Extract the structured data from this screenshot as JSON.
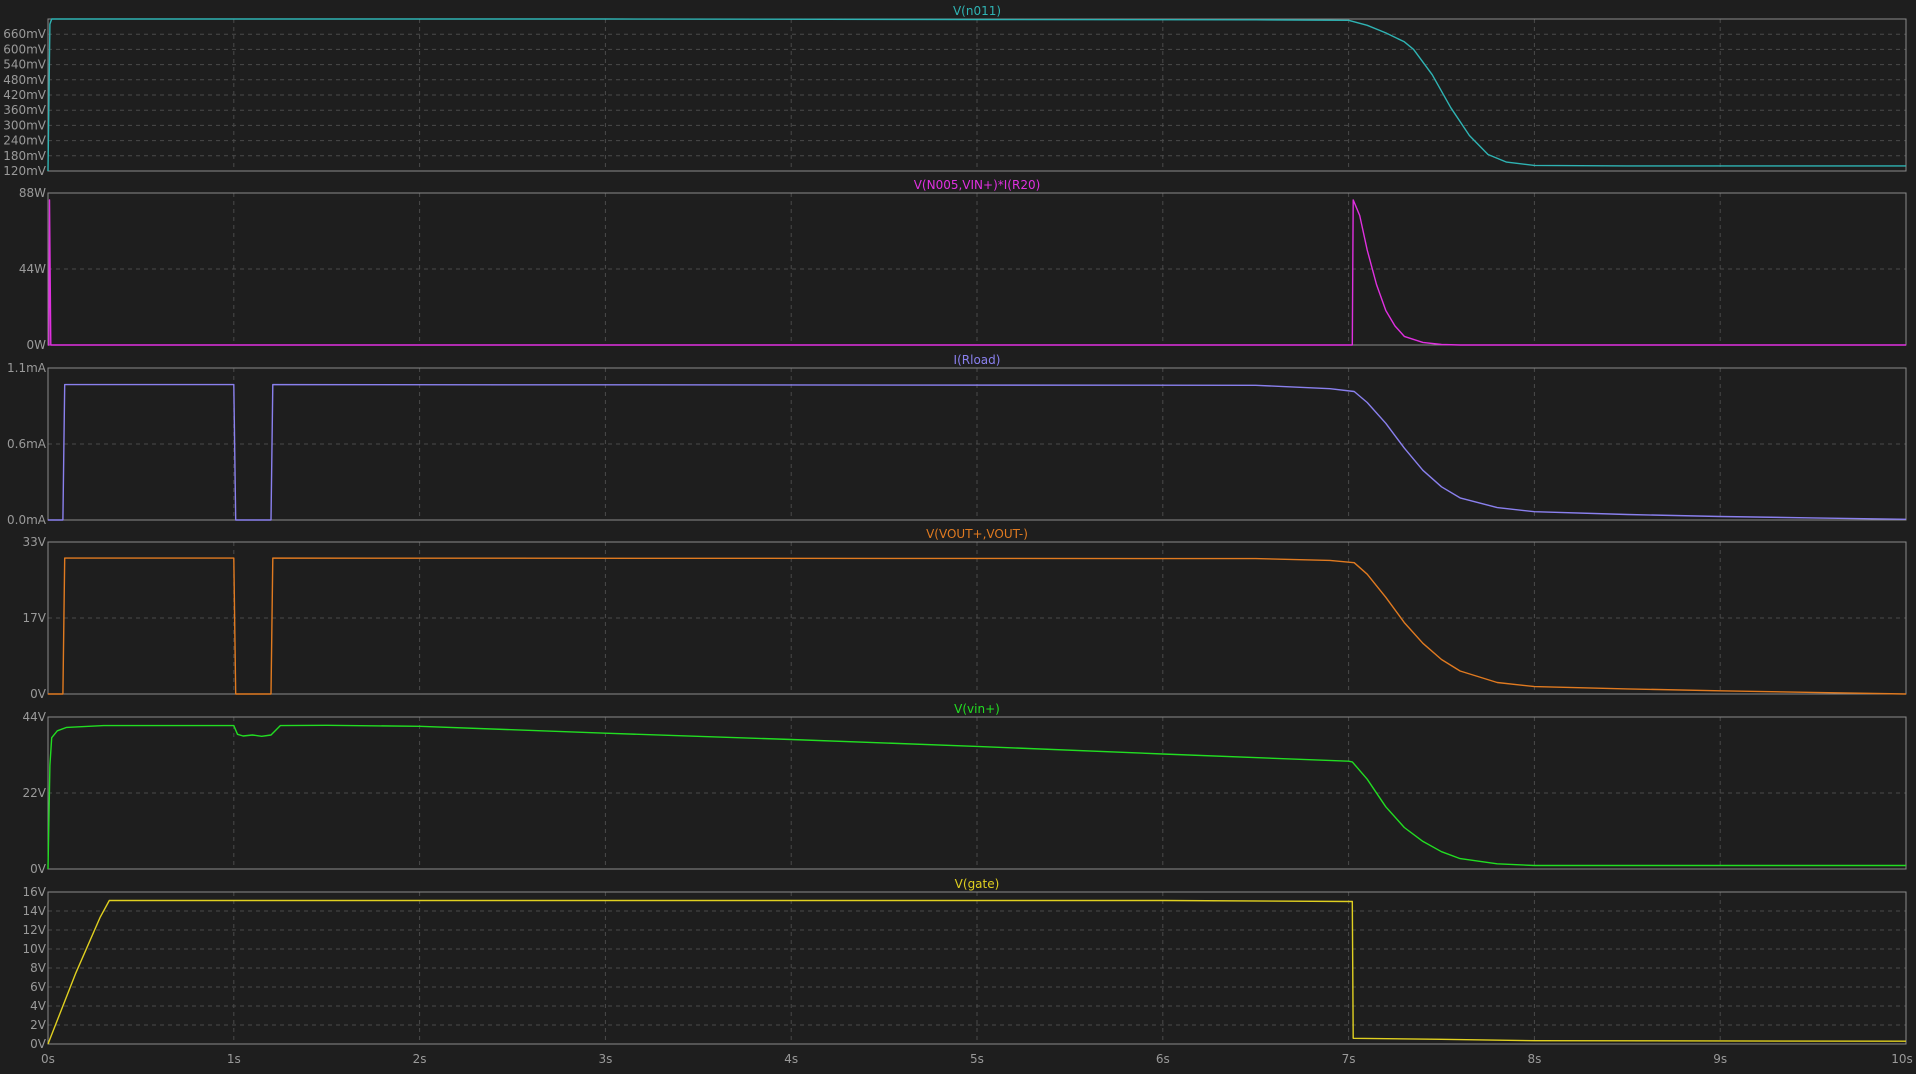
{
  "chart_data": {
    "type": "line",
    "x_ticks": [
      "0s",
      "1s",
      "2s",
      "3s",
      "4s",
      "5s",
      "6s",
      "7s",
      "8s",
      "9s",
      "10s"
    ],
    "xlim": [
      0,
      10
    ],
    "grid": true,
    "panes": [
      {
        "id": "n011",
        "title": "V(n011)",
        "color": "#2fb3b3",
        "ylim": [
          0.12,
          0.72
        ],
        "y_ticks": [
          "120mV",
          "180mV",
          "240mV",
          "300mV",
          "360mV",
          "420mV",
          "480mV",
          "540mV",
          "600mV",
          "660mV"
        ],
        "y_tick_values": [
          0.12,
          0.18,
          0.24,
          0.3,
          0.36,
          0.42,
          0.48,
          0.54,
          0.6,
          0.66
        ],
        "points": [
          [
            0,
            0.12
          ],
          [
            0.01,
            0.7
          ],
          [
            0.02,
            0.72
          ],
          [
            1.0,
            0.72
          ],
          [
            1.3,
            0.72
          ],
          [
            2.0,
            0.72
          ],
          [
            3.0,
            0.72
          ],
          [
            5.0,
            0.718
          ],
          [
            6.5,
            0.717
          ],
          [
            7.0,
            0.715
          ],
          [
            7.1,
            0.695
          ],
          [
            7.2,
            0.665
          ],
          [
            7.3,
            0.63
          ],
          [
            7.35,
            0.6
          ],
          [
            7.45,
            0.5
          ],
          [
            7.55,
            0.37
          ],
          [
            7.65,
            0.26
          ],
          [
            7.75,
            0.185
          ],
          [
            7.85,
            0.155
          ],
          [
            8.0,
            0.142
          ],
          [
            8.5,
            0.14
          ],
          [
            9.0,
            0.14
          ],
          [
            10.0,
            0.14
          ]
        ]
      },
      {
        "id": "r20",
        "title": "V(N005,VIN+)*I(R20)",
        "color": "#e030e0",
        "ylim": [
          0,
          88
        ],
        "y_ticks": [
          "0W",
          "44W",
          "88W"
        ],
        "y_tick_values": [
          0,
          44,
          88
        ],
        "points": [
          [
            0,
            0
          ],
          [
            0.005,
            0
          ],
          [
            0.008,
            84
          ],
          [
            0.015,
            0
          ],
          [
            7.02,
            0
          ],
          [
            7.025,
            84
          ],
          [
            7.06,
            75
          ],
          [
            7.1,
            55
          ],
          [
            7.15,
            35
          ],
          [
            7.2,
            20
          ],
          [
            7.25,
            11
          ],
          [
            7.3,
            5
          ],
          [
            7.4,
            1.5
          ],
          [
            7.5,
            0.3
          ],
          [
            7.6,
            0
          ],
          [
            10,
            0
          ]
        ]
      },
      {
        "id": "rload",
        "title": "I(Rload)",
        "color": "#8a80ee",
        "ylim": [
          0,
          1.1
        ],
        "y_ticks": [
          "0.0mA",
          "0.6mA",
          "1.1mA"
        ],
        "y_tick_values": [
          0,
          0.55,
          1.1
        ],
        "points": [
          [
            0,
            0
          ],
          [
            0.08,
            0
          ],
          [
            0.09,
            0.98
          ],
          [
            1.0,
            0.98
          ],
          [
            1.01,
            0
          ],
          [
            1.2,
            0
          ],
          [
            1.21,
            0.98
          ],
          [
            6.5,
            0.975
          ],
          [
            6.9,
            0.95
          ],
          [
            7.03,
            0.93
          ],
          [
            7.1,
            0.85
          ],
          [
            7.2,
            0.7
          ],
          [
            7.3,
            0.52
          ],
          [
            7.4,
            0.36
          ],
          [
            7.5,
            0.24
          ],
          [
            7.6,
            0.16
          ],
          [
            7.8,
            0.09
          ],
          [
            8.0,
            0.06
          ],
          [
            8.5,
            0.04
          ],
          [
            9.0,
            0.025
          ],
          [
            9.5,
            0.015
          ],
          [
            10.0,
            0.005
          ]
        ]
      },
      {
        "id": "vout",
        "title": "V(VOUT+,VOUT-)",
        "color": "#e07a20",
        "ylim": [
          0,
          33
        ],
        "y_ticks": [
          "0V",
          "17V",
          "33V"
        ],
        "y_tick_values": [
          0,
          16.5,
          33
        ],
        "points": [
          [
            0,
            0
          ],
          [
            0.08,
            0
          ],
          [
            0.09,
            29.5
          ],
          [
            1.0,
            29.5
          ],
          [
            1.01,
            0
          ],
          [
            1.2,
            0
          ],
          [
            1.21,
            29.5
          ],
          [
            6.5,
            29.4
          ],
          [
            6.9,
            29
          ],
          [
            7.03,
            28.5
          ],
          [
            7.1,
            26
          ],
          [
            7.2,
            21
          ],
          [
            7.3,
            15.5
          ],
          [
            7.4,
            11
          ],
          [
            7.5,
            7.5
          ],
          [
            7.6,
            5
          ],
          [
            7.8,
            2.5
          ],
          [
            8.0,
            1.6
          ],
          [
            8.5,
            1.1
          ],
          [
            9.0,
            0.7
          ],
          [
            9.5,
            0.35
          ],
          [
            10.0,
            0
          ]
        ]
      },
      {
        "id": "vin",
        "title": "V(vin+)",
        "color": "#22dd22",
        "ylim": [
          0,
          44
        ],
        "y_ticks": [
          "0V",
          "22V",
          "44V"
        ],
        "y_tick_values": [
          0,
          22,
          44
        ],
        "points": [
          [
            0,
            0
          ],
          [
            0.01,
            30
          ],
          [
            0.02,
            38
          ],
          [
            0.05,
            40
          ],
          [
            0.1,
            41
          ],
          [
            0.3,
            41.5
          ],
          [
            1.0,
            41.5
          ],
          [
            1.02,
            39
          ],
          [
            1.05,
            38.5
          ],
          [
            1.1,
            38.8
          ],
          [
            1.15,
            38.4
          ],
          [
            1.2,
            38.8
          ],
          [
            1.25,
            41.5
          ],
          [
            1.5,
            41.6
          ],
          [
            2.0,
            41.3
          ],
          [
            3.0,
            39.3
          ],
          [
            4.0,
            37.5
          ],
          [
            5.0,
            35.5
          ],
          [
            6.0,
            33.3
          ],
          [
            7.0,
            31.2
          ],
          [
            7.02,
            31
          ],
          [
            7.1,
            26
          ],
          [
            7.2,
            18
          ],
          [
            7.3,
            12
          ],
          [
            7.4,
            8
          ],
          [
            7.5,
            5
          ],
          [
            7.6,
            3
          ],
          [
            7.8,
            1.5
          ],
          [
            8.0,
            1.0
          ],
          [
            9.0,
            1.0
          ],
          [
            10.0,
            1.0
          ]
        ]
      },
      {
        "id": "gate",
        "title": "V(gate)",
        "color": "#e0d020",
        "ylim": [
          0,
          16
        ],
        "y_ticks": [
          "0V",
          "2V",
          "4V",
          "6V",
          "8V",
          "10V",
          "12V",
          "14V",
          "16V"
        ],
        "y_tick_values": [
          0,
          2,
          4,
          6,
          8,
          10,
          12,
          14,
          16
        ],
        "points": [
          [
            0,
            0
          ],
          [
            0.15,
            7.5
          ],
          [
            0.28,
            13.3
          ],
          [
            0.33,
            15.1
          ],
          [
            6.0,
            15.1
          ],
          [
            7.02,
            15.0
          ],
          [
            7.025,
            0.6
          ],
          [
            7.5,
            0.5
          ],
          [
            8.0,
            0.35
          ],
          [
            10.0,
            0.3
          ]
        ]
      }
    ]
  }
}
